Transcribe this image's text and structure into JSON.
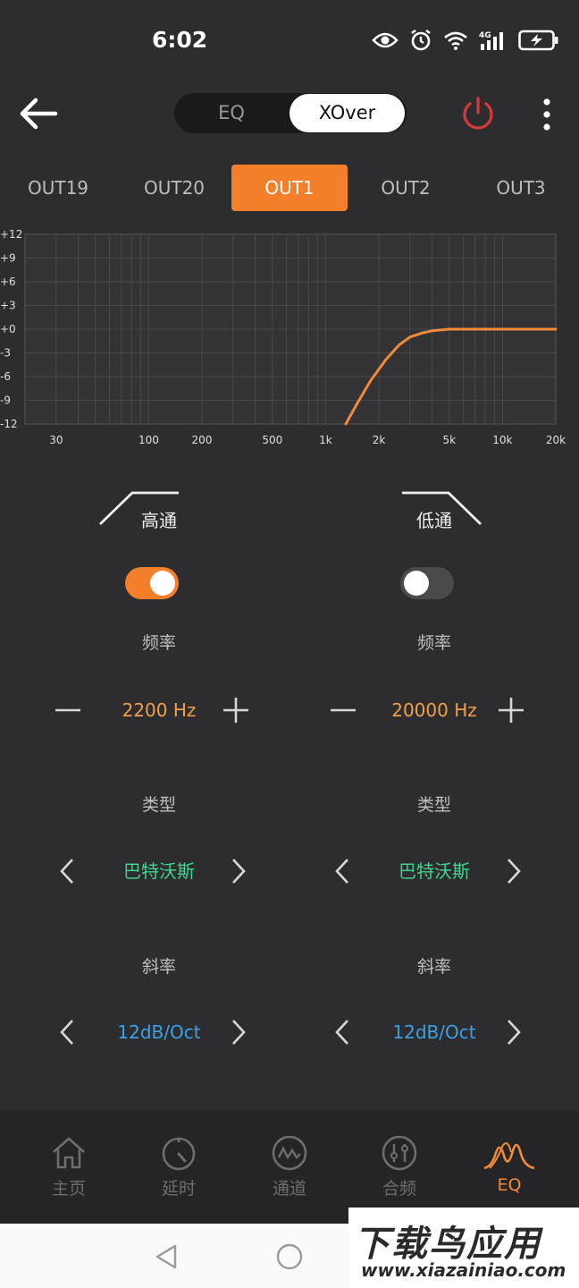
{
  "status": {
    "time": "6:02"
  },
  "header": {
    "seg_eq": "EQ",
    "seg_xover": "XOver"
  },
  "tabs": [
    "OUT19",
    "OUT20",
    "OUT1",
    "OUT2",
    "OUT3"
  ],
  "chart_data": {
    "type": "line",
    "y_ticks": [
      "+12",
      "+9",
      "+6",
      "+3",
      "+0",
      "-3",
      "-6",
      "-9",
      "-12"
    ],
    "x_ticks": [
      "30",
      "100",
      "200",
      "500",
      "1k",
      "2k",
      "5k",
      "10k",
      "20k"
    ],
    "xscale": "log",
    "xlim": [
      20,
      20000
    ],
    "ylim": [
      -12,
      12
    ],
    "grid": true,
    "series": [
      {
        "color": "#f08a3a",
        "x": [
          1300,
          1500,
          1800,
          2200,
          2600,
          3000,
          3500,
          4000,
          5000,
          7000,
          10000,
          20000
        ],
        "y": [
          -12,
          -9.5,
          -6.5,
          -3.8,
          -2.0,
          -1.0,
          -0.5,
          -0.2,
          0,
          0,
          0,
          0
        ]
      }
    ]
  },
  "highpass": {
    "title": "高通",
    "enabled": true,
    "freq_label": "频率",
    "freq_value": "2200 Hz",
    "type_label": "类型",
    "type_value": "巴特沃斯",
    "slope_label": "斜率",
    "slope_value": "12dB/Oct"
  },
  "lowpass": {
    "title": "低通",
    "enabled": false,
    "freq_label": "频率",
    "freq_value": "20000 Hz",
    "type_label": "类型",
    "type_value": "巴特沃斯",
    "slope_label": "斜率",
    "slope_value": "12dB/Oct"
  },
  "nav": [
    {
      "label": "主页",
      "icon": "home-icon"
    },
    {
      "label": "延时",
      "icon": "timer-icon"
    },
    {
      "label": "通道",
      "icon": "channel-icon"
    },
    {
      "label": "合频",
      "icon": "mixer-icon"
    },
    {
      "label": "EQ",
      "icon": "eq-icon",
      "active": true
    }
  ],
  "watermark": {
    "main": "下载鸟应用",
    "url": "www.xiazainiao.com"
  },
  "colors": {
    "accent": "#f47f2a",
    "freq": "#f0a04a",
    "type": "#3fd38e",
    "slope": "#3ba1e3",
    "power": "#d63a3a"
  }
}
